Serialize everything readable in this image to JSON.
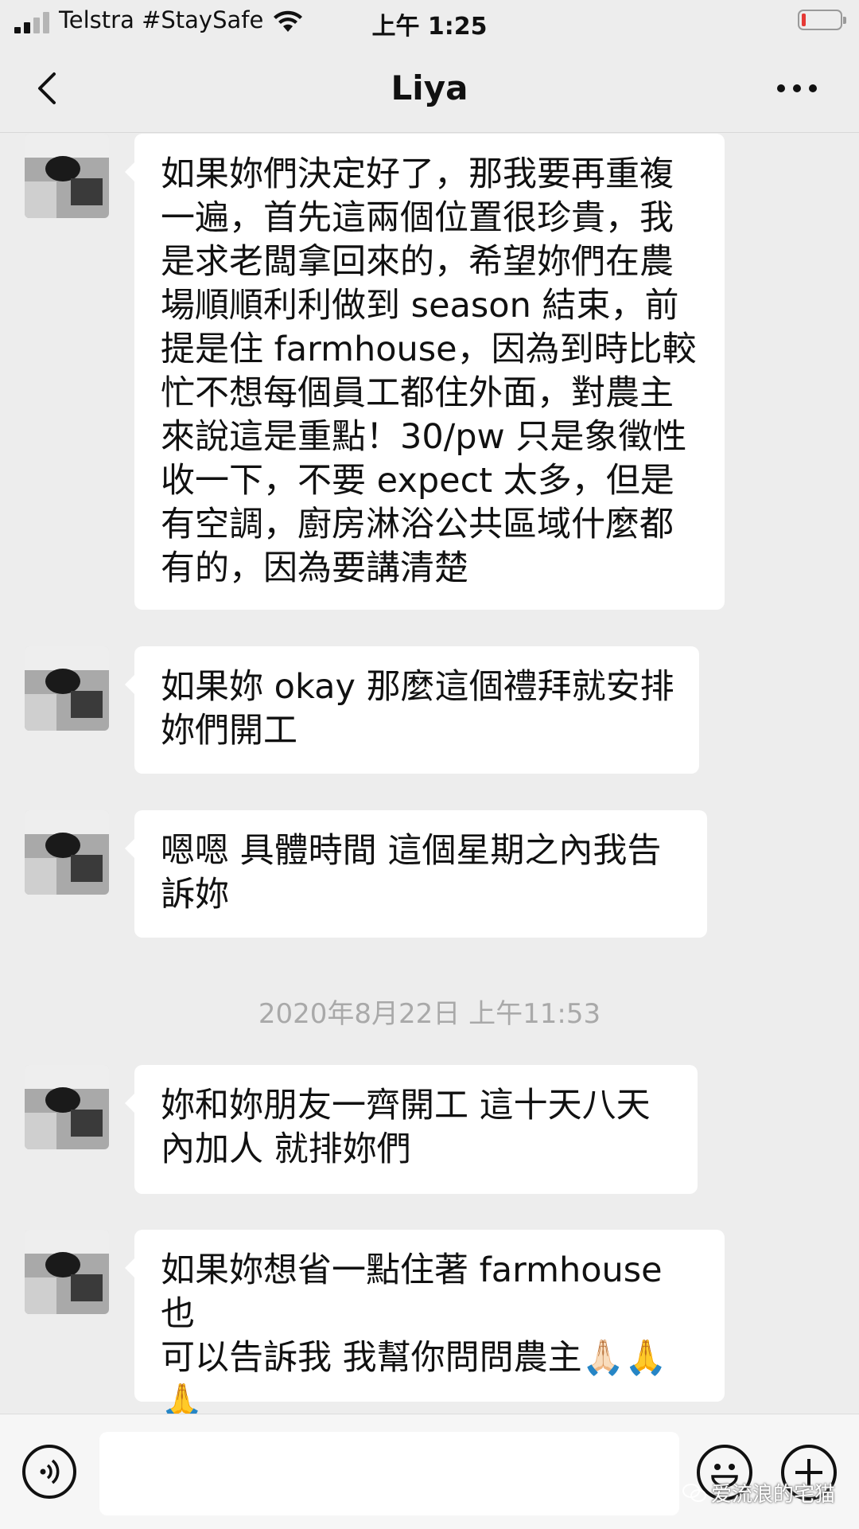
{
  "status_bar": {
    "carrier": "Telstra #StaySafe",
    "time": "上午 1:25",
    "signal_bars": 2,
    "battery_level": 0.1,
    "battery_color": "#e53935"
  },
  "nav": {
    "title": "Liya",
    "back_icon": "chevron-left-icon",
    "more_icon": "more-dots-icon"
  },
  "messages": [
    {
      "sender": "Liya",
      "text": "如果妳們決定好了，那我要再重複\n一遍，首先這兩個位置很珍貴，我\n是求老闆拿回來的，希望妳們在農\n場順順利利做到 season 結束，前\n提是住 farmhouse，因為到時比較\n忙不想每個員工都住外面，對農主\n來說這是重點！30/pw 只是象徵性\n收一下，不要 expect 太多，但是\n有空調，廚房淋浴公共區域什麼都\n有的，因為要講清楚"
    },
    {
      "sender": "Liya",
      "text": "如果妳 okay 那麼這個禮拜就安排\n妳們開工"
    },
    {
      "sender": "Liya",
      "text": "嗯嗯 具體時間 這個星期之內我告\n訴妳"
    },
    {
      "sender": "Liya",
      "text": "妳和妳朋友一齊開工 這十天八天\n內加人 就排妳們"
    },
    {
      "sender": "Liya",
      "text": "如果妳想省一點住著 farmhouse 也\n可以告訴我 我幫你問問農主🙏🏻🙏\n🙏"
    }
  ],
  "timestamp": "2020年8月22日 上午11:53",
  "input_bar": {
    "voice_icon": "voice-icon",
    "emoji_icon": "emoji-icon",
    "add_icon": "plus-icon",
    "text_value": ""
  },
  "watermark": "爱流浪的宅猫",
  "colors": {
    "background": "#ededed",
    "bubble": "#ffffff",
    "timestamp": "#a9a9a9"
  }
}
